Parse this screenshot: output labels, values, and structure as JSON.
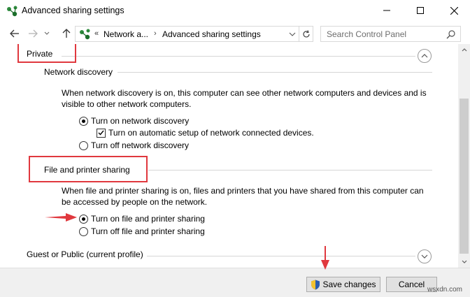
{
  "window": {
    "title": "Advanced sharing settings",
    "controls": {
      "minimize": "minimize",
      "maximize": "maximize",
      "close": "close"
    }
  },
  "address": {
    "prefix": "«",
    "crumb1": "Network a...",
    "separator": "›",
    "crumb2": "Advanced sharing settings"
  },
  "search": {
    "placeholder": "Search Control Panel"
  },
  "sections": {
    "private": {
      "title": "Private",
      "network_discovery": {
        "title": "Network discovery",
        "description_line1": "When network discovery is on, this computer can see other network computers and devices and is",
        "description_line2": "visible to other network computers.",
        "option_on": "Turn on network discovery",
        "option_auto": "Turn on automatic setup of network connected devices.",
        "option_off": "Turn off network discovery",
        "selected": "on",
        "auto_setup_checked": true
      },
      "file_printer": {
        "title": "File and printer sharing",
        "description_line1": "When file and printer sharing is on, files and printers that you have shared from this computer can",
        "description_line2": "be accessed by people on the network.",
        "option_on": "Turn on file and printer sharing",
        "option_off": "Turn off file and printer sharing",
        "selected": "on"
      }
    },
    "guest": {
      "title": "Guest or Public (current profile)"
    }
  },
  "footer": {
    "save_label": "Save changes",
    "cancel_label": "Cancel"
  },
  "watermark": "wsxdn.com",
  "colors": {
    "annotation_red": "#e0383e",
    "footer_bg": "#f0f0f0",
    "button_bg": "#e1e1e1"
  }
}
